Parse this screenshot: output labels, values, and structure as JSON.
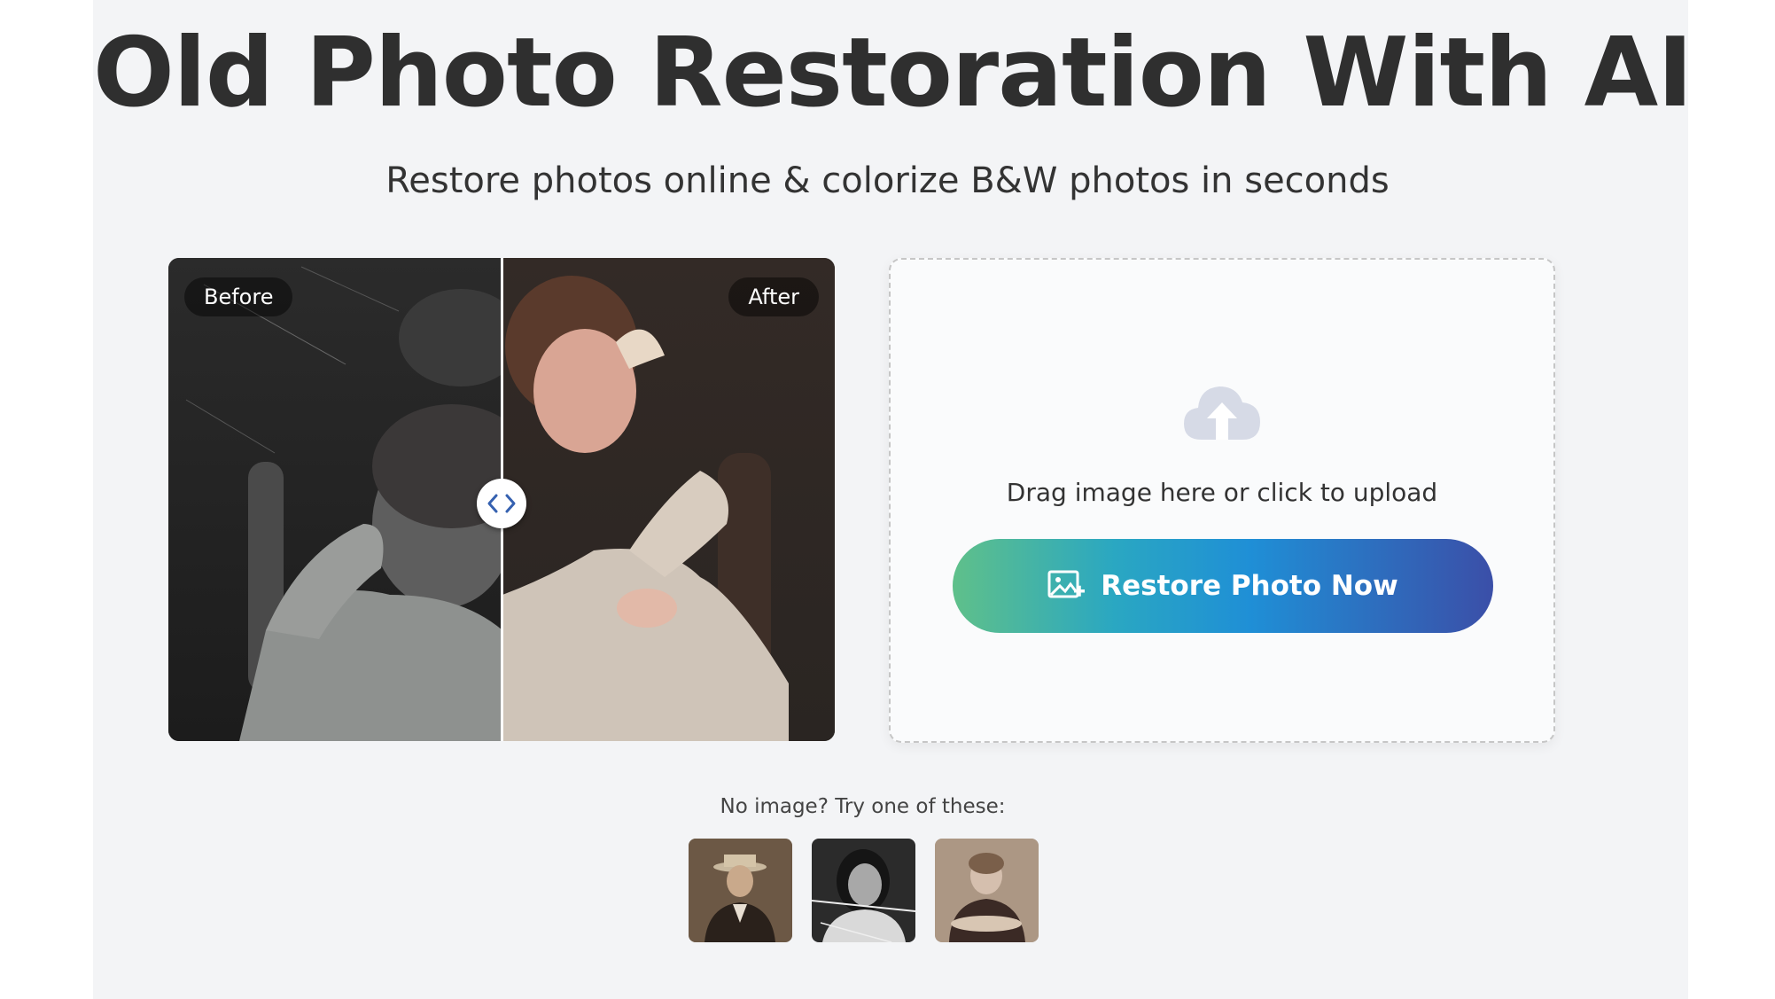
{
  "hero": {
    "title": "Old Photo Restoration With AI",
    "subtitle": "Restore photos online & colorize B&W photos in seconds"
  },
  "comparison": {
    "before_label": "Before",
    "after_label": "After"
  },
  "upload": {
    "icon": "cloud-upload-icon",
    "prompt": "Drag image here or click to upload",
    "button_label": "Restore Photo Now",
    "button_icon": "add-image-icon"
  },
  "samples": {
    "label": "No image? Try one of these:",
    "items": [
      "sample-photo-man-hat",
      "sample-photo-woman",
      "sample-photo-child"
    ]
  },
  "colors": {
    "title": "#2f2f2f",
    "background": "#f3f4f6",
    "button_gradient_start": "#5fc08a",
    "button_gradient_end": "#3b4fa8"
  }
}
